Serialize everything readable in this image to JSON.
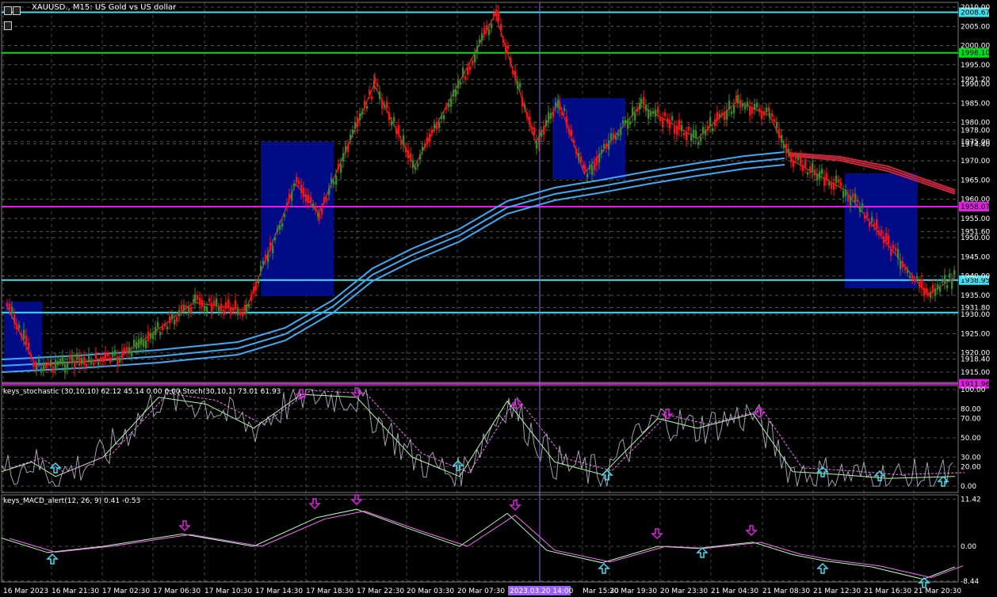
{
  "window": {
    "title": "XAUUSD., M15:  US Gold vs US dollar",
    "icon": "chart-window-icon"
  },
  "indicators": {
    "stoch_header": "keys_stochastic (30,10,10) 62.12 45.14 0.00 0.00 Stoch(30,10,1) 73.01 61.93",
    "macd_header": "keys_MACD_alert(12, 26, 9) 0.41 -0.53"
  },
  "colors": {
    "background": "#000000",
    "bull_candle": "#3a8a2a",
    "bear_candle": "#ff1010",
    "zone_fill": "#000c8c",
    "ma_blue": "#3fa9f5",
    "ma_red": "#c8283c",
    "cyan_level": "#40e0f0",
    "green_level": "#00e020",
    "magenta_level": "#e020e0",
    "grid": "#9a9a9a",
    "signal_up_arrow": "#40e0f0",
    "signal_down_arrow": "#e020e0"
  },
  "price_axis": {
    "labels": [
      "2010.00",
      "2005.00",
      "2000.00",
      "1995.00",
      "1991.20",
      "1990.00",
      "1985.00",
      "1980.00",
      "1978.00",
      "1975.00",
      "1974.40",
      "1970.00",
      "1965.00",
      "1960.00",
      "1955.00",
      "1951.60",
      "1950.00",
      "1945.00",
      "1940.00",
      "1935.00",
      "1931.80",
      "1930.00",
      "1925.00",
      "1920.00",
      "1918.40",
      "1915.00"
    ],
    "badges": {
      "top_cyan": "2008.67",
      "green": "1998.10",
      "magenta": "1958.07",
      "current": "1938.95",
      "bottom_magenta": "1911.96"
    }
  },
  "stoch_axis": [
    "100.00",
    "80.00",
    "70.00",
    "50.00",
    "30.00",
    "20.00",
    "0.00"
  ],
  "macd_axis": [
    "11.42",
    "0.00",
    "-8.44"
  ],
  "time_axis": {
    "labels": [
      "16 Mar 2023",
      "16 Mar 21:30",
      "17 Mar 02:30",
      "17 Mar 06:30",
      "17 Mar 10:30",
      "17 Mar 14:30",
      "17 Mar 18:30",
      "17 Mar 22:30",
      "20 Mar 03:30",
      "20 Mar 07:30",
      "Mar 15:30",
      "20 Mar 19:30",
      "20 Mar 23:30",
      "21 Mar 04:30",
      "21 Mar 08:30",
      "21 Mar 12:30",
      "21 Mar 16:30",
      "21 Mar 20:30"
    ],
    "crosshair_label": "2023.03.20 14:00"
  }
}
